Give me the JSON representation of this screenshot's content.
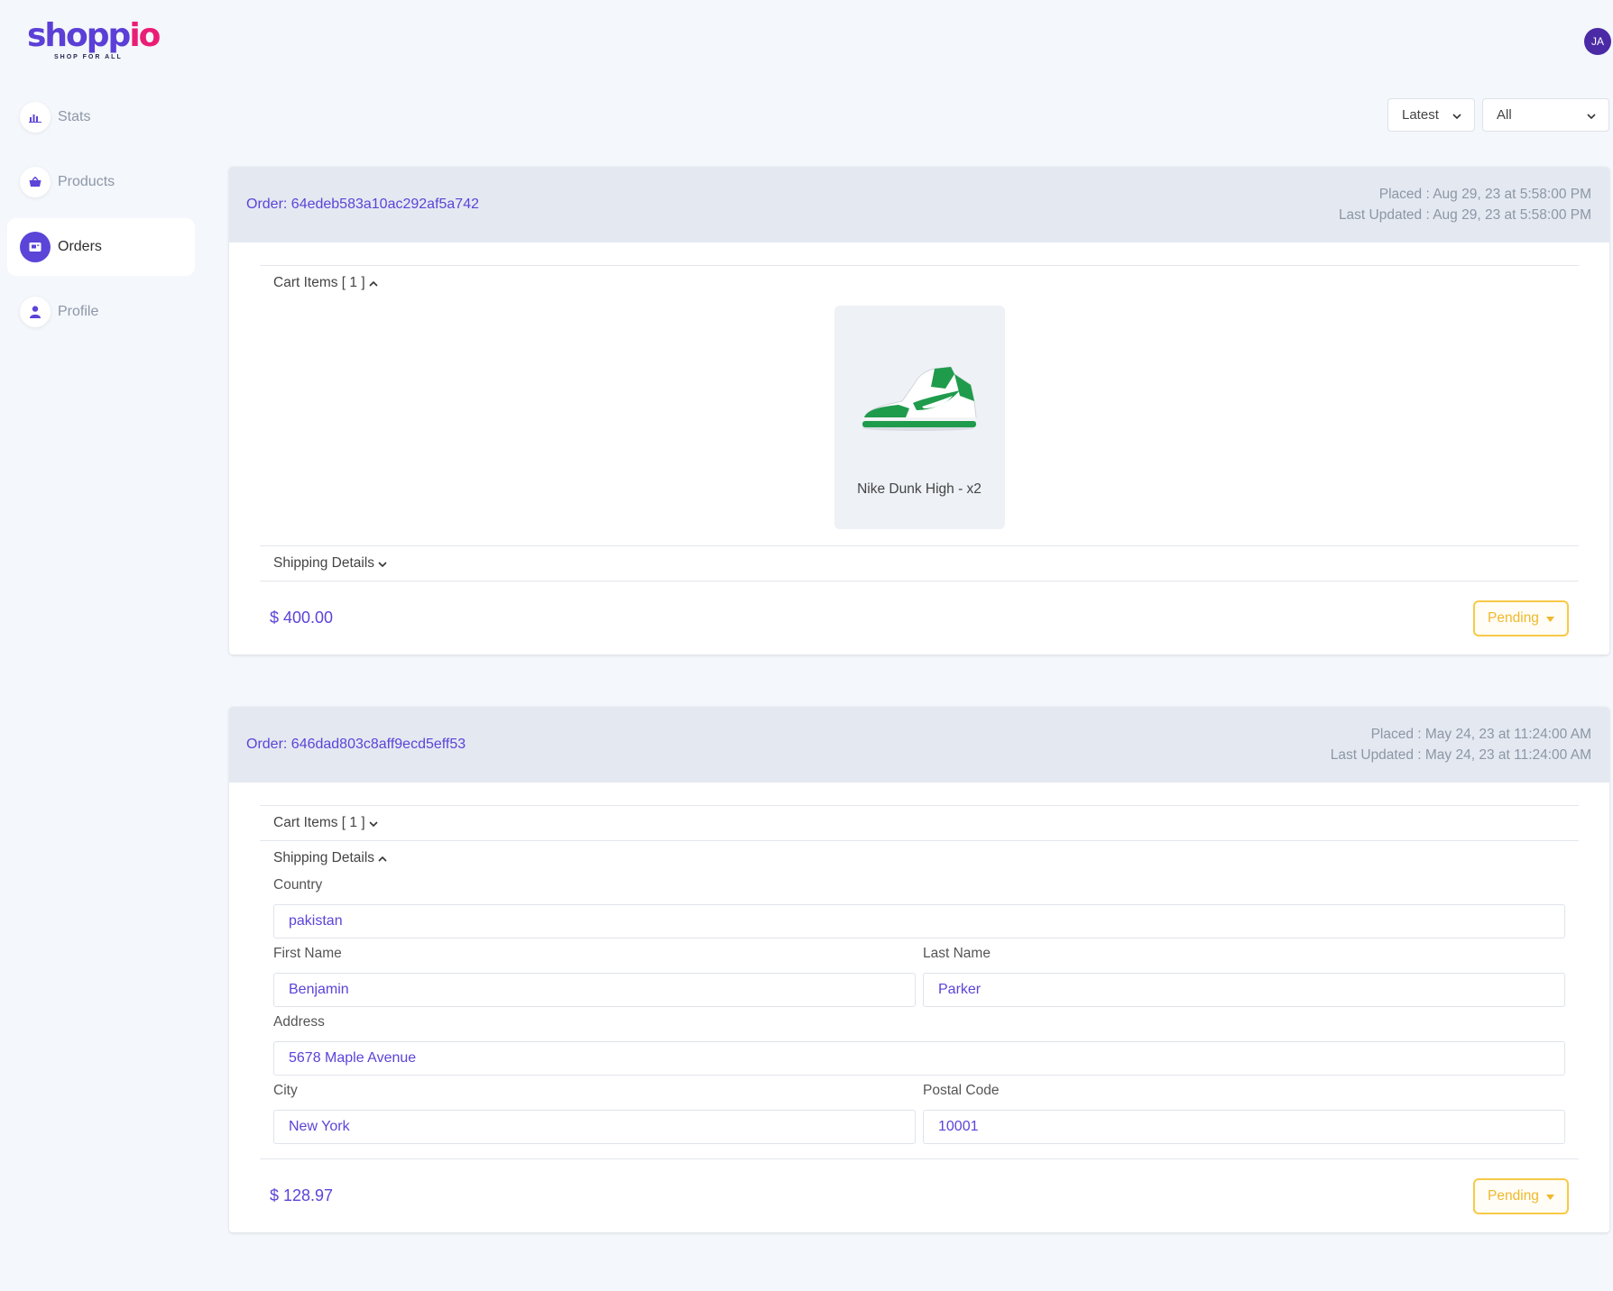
{
  "logo": {
    "word_a": "shopp",
    "word_b": "io",
    "tagline": "SHOP FOR ALL"
  },
  "user": {
    "initials": "JA"
  },
  "sidebar": {
    "items": [
      {
        "label": "Stats",
        "icon": "bar-chart-icon"
      },
      {
        "label": "Products",
        "icon": "basket-icon"
      },
      {
        "label": "Orders",
        "icon": "orders-icon",
        "active": true
      },
      {
        "label": "Profile",
        "icon": "user-icon"
      }
    ]
  },
  "filters": {
    "sort_value": "Latest",
    "status_value": "All"
  },
  "orders": [
    {
      "id_label": "Order: 64edeb583a10ac292af5a742",
      "placed": "Placed  : Aug 29, 23 at 5:58:00 PM",
      "updated": "Last Updated  : Aug 29, 23 at 5:58:00 PM",
      "cart_label": "Cart Items [ 1 ]",
      "cart_expanded": true,
      "items": [
        {
          "name": "Nike Dunk High - x2"
        }
      ],
      "shipping_label": "Shipping Details",
      "total": "$ 400.00",
      "status": "Pending"
    },
    {
      "id_label": "Order: 646dad803c8aff9ecd5eff53",
      "placed": "Placed  : May 24, 23 at 11:24:00 AM",
      "updated": "Last Updated  : May 24, 23 at 11:24:00 AM",
      "cart_label": "Cart Items [ 1 ]",
      "shipping_label": "Shipping Details",
      "shipping_expanded": true,
      "shipping": {
        "country_label": "Country",
        "country": "pakistan",
        "first_name_label": "First Name",
        "first_name": "Benjamin",
        "last_name_label": "Last Name",
        "last_name": "Parker",
        "address_label": "Address",
        "address": "5678 Maple Avenue",
        "city_label": "City",
        "city": "New York",
        "postal_label": "Postal Code",
        "postal": "10001"
      },
      "total": "$ 128.97",
      "status": "Pending"
    }
  ],
  "colors": {
    "accent": "#5b44d8",
    "brand_pink": "#ea1d76",
    "pending": "#f7c948"
  }
}
